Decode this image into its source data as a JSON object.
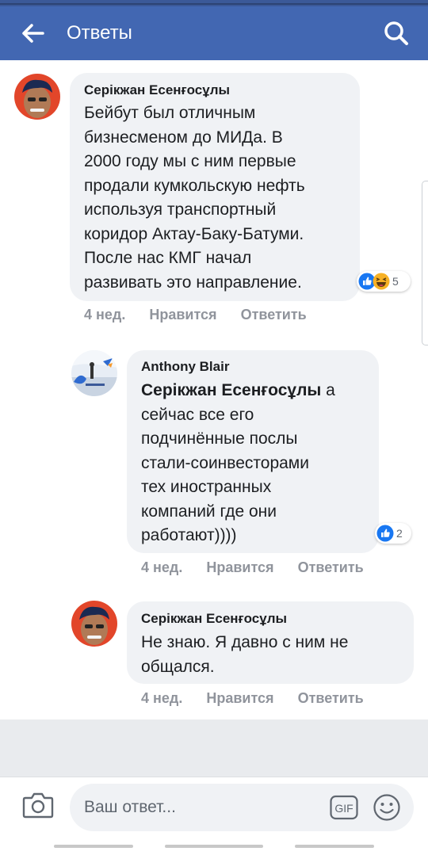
{
  "header": {
    "title": "Ответы",
    "bg_color": "#4267b2"
  },
  "comments": [
    {
      "author": "Серікжан Есенғосұлы",
      "lines": [
        "Бейбут был отличным",
        "бизнесменом до МИДа. В",
        "2000 году мы с ним первые",
        "продали кумкольскую нефть",
        "используя транспортный",
        "коридор Актау-Баку-Батуми.",
        "После нас КМГ начал",
        "развивать это направление."
      ],
      "reactions": {
        "icons": [
          "like-icon",
          "haha-icon"
        ],
        "count": "5"
      },
      "time": "4 нед.",
      "like_label": "Нравится",
      "reply_label": "Ответить"
    },
    {
      "author": "Anthony Blair",
      "mention": "Серікжан Есенғосұлы",
      "first_line_rest": " а",
      "lines": [
        "сейчас все его",
        "подчинённые послы",
        "стали-соинвесторами",
        "тех иностранных",
        "компаний где они",
        "работают))))"
      ],
      "reactions": {
        "icons": [
          "like-icon"
        ],
        "count": "2"
      },
      "time": "4 нед.",
      "like_label": "Нравится",
      "reply_label": "Ответить"
    },
    {
      "author": "Серікжан Есенғосұлы",
      "lines": [
        "Не знаю. Я давно с ним не",
        "общался."
      ],
      "time": "4 нед.",
      "like_label": "Нравится",
      "reply_label": "Ответить"
    }
  ],
  "composer": {
    "placeholder": "Ваш ответ...",
    "gif_label": "GIF"
  }
}
